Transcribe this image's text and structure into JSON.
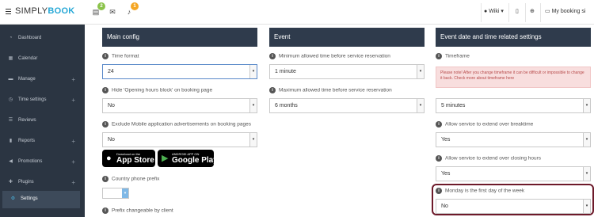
{
  "topbar": {
    "logo_left": "SIMPLY",
    "logo_right": "BOOK",
    "badge_tasks": "2",
    "badge_bell": "1",
    "user_label": "Wiki",
    "site_label": "My booking si"
  },
  "sidebar": {
    "items": [
      {
        "label": "Dashboard",
        "icon": "dashboard-icon",
        "glyph": "◔",
        "plus": ""
      },
      {
        "label": "Calendar",
        "icon": "calendar-icon",
        "glyph": "▦",
        "plus": ""
      },
      {
        "label": "Manage",
        "icon": "manage-icon",
        "glyph": "▬",
        "plus": "+"
      },
      {
        "label": "Time settings",
        "icon": "clock-icon",
        "glyph": "◷",
        "plus": "+"
      },
      {
        "label": "Reviews",
        "icon": "reviews-icon",
        "glyph": "☰",
        "plus": ""
      },
      {
        "label": "Reports",
        "icon": "reports-icon",
        "glyph": "▮",
        "plus": "+"
      },
      {
        "label": "Promotions",
        "icon": "promotions-icon",
        "glyph": "◀",
        "plus": "+"
      },
      {
        "label": "Plugins",
        "icon": "plugins-icon",
        "glyph": "✚",
        "plus": "+"
      },
      {
        "label": "Settings",
        "icon": "settings-icon",
        "glyph": "⚙",
        "plus": ""
      }
    ]
  },
  "main_config": {
    "title": "Main config",
    "time_format_label": "Time format",
    "time_format_value": "24",
    "hide_hours_label": "Hide 'Opening hours block' on booking page",
    "hide_hours_value": "No",
    "exclude_ads_label": "Exclude Mobile application advertisements on booking pages",
    "exclude_ads_value": "No",
    "appstore_small": "Download on the",
    "appstore_big": "App Store",
    "googleplay_small": "ANDROID APP ON",
    "googleplay_big": "Google Play",
    "phone_prefix_label": "Country phone prefix",
    "prefix_changeable_label": "Prefix changeable by client"
  },
  "event": {
    "title": "Event",
    "min_time_label": "Minimum allowed time before service reservation",
    "min_time_value": "1 minute",
    "max_time_label": "Maximum allowed time before service reservation",
    "max_time_value": "6 months"
  },
  "event_date": {
    "title": "Event date and time related settings",
    "timeframe_label": "Timeframe",
    "warning_text": "Please note! After you change timeframe it can be difficult or impossible to change it back. Check more about timeframe here",
    "timeframe_value": "5 minutes",
    "extend_breaktime_label": "Allow service to extend over breaktime",
    "extend_breaktime_value": "Yes",
    "extend_closing_label": "Allow service to extend over closing hours",
    "extend_closing_value": "Yes",
    "monday_first_label": "Monday is the first day of the week",
    "monday_first_value": "No"
  },
  "colors": {
    "sidebar_bg": "#2b3542",
    "header_bg": "#2f3b4c",
    "accent": "#27a8d6",
    "highlight_border": "#6d1a2a",
    "warning_bg": "#f8dede"
  }
}
